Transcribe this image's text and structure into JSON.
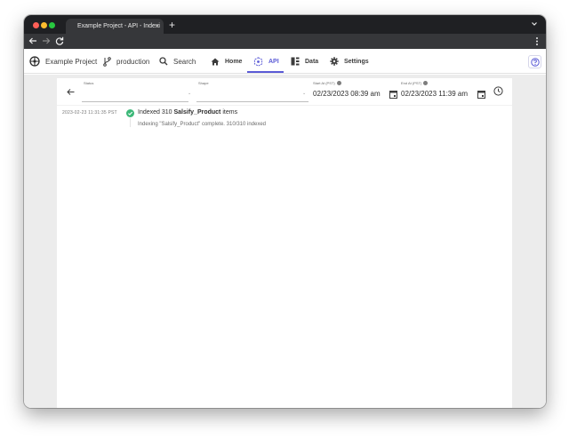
{
  "browser": {
    "tab_title": "Example Project - API - Indexi",
    "tab_close": "×",
    "new_tab": "+"
  },
  "appbar": {
    "project": "Example Project",
    "branch": "production",
    "search": "Search",
    "home": "Home",
    "api": "API",
    "data": "Data",
    "settings": "Settings",
    "active_tab": "API",
    "accent_color": "#5b5bd6"
  },
  "filters": {
    "status_label": "Status",
    "shape_label": "Shape",
    "start_label": "Start At (PST)",
    "start_value": "02/23/2023 08:39 am",
    "end_label": "End At (PST)",
    "end_value": "02/23/2023 11:39 am"
  },
  "log": {
    "timestamp": "2023-02-23 11:31:35 PST",
    "prefix": "Indexed 310 ",
    "item_name": "Salsify_Product",
    "suffix": " items",
    "detail": "Indexing \"Salsify_Product\" complete. 310/310 indexed",
    "status_color": "#3cb878"
  }
}
